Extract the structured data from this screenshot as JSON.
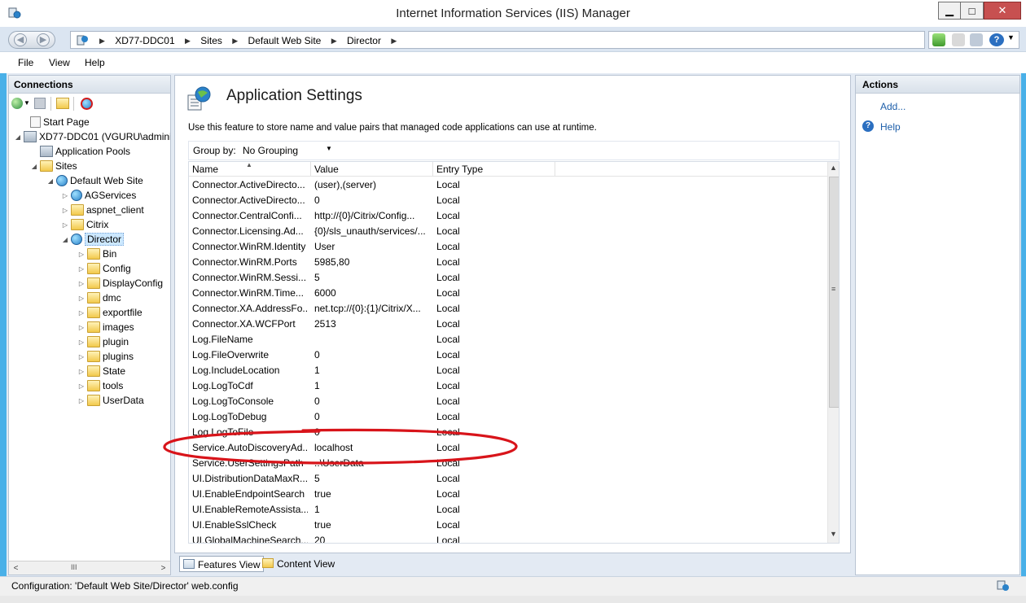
{
  "window": {
    "title": "Internet Information Services (IIS) Manager",
    "min_glyph": "▁",
    "max_glyph": "□",
    "close_glyph": "✕"
  },
  "address": {
    "crumbs": [
      "XD77-DDC01",
      "Sites",
      "Default Web Site",
      "Director"
    ]
  },
  "menu": {
    "file": "File",
    "view": "View",
    "help": "Help"
  },
  "connections": {
    "title": "Connections",
    "tree": [
      {
        "label": "Start Page",
        "icon": "page-icon"
      },
      {
        "label": "XD77-DDC01 (VGURU\\admini",
        "icon": "server-icon"
      },
      {
        "label": "Application Pools",
        "icon": "app-pools-icon"
      },
      {
        "label": "Sites",
        "icon": "sites-folder-icon"
      },
      {
        "label": "Default Web Site",
        "icon": "globe-icon"
      },
      {
        "label": "AGServices",
        "icon": "app-icon"
      },
      {
        "label": "aspnet_client",
        "icon": "folder-icon"
      },
      {
        "label": "Citrix",
        "icon": "folder-icon"
      },
      {
        "label": "Director",
        "icon": "app-icon"
      },
      {
        "label": "Bin",
        "icon": "folder-icon"
      },
      {
        "label": "Config",
        "icon": "folder-icon"
      },
      {
        "label": "DisplayConfig",
        "icon": "folder-icon"
      },
      {
        "label": "dmc",
        "icon": "folder-icon"
      },
      {
        "label": "exportfile",
        "icon": "folder-icon"
      },
      {
        "label": "images",
        "icon": "folder-icon"
      },
      {
        "label": "plugin",
        "icon": "folder-icon"
      },
      {
        "label": "plugins",
        "icon": "folder-icon"
      },
      {
        "label": "State",
        "icon": "folder-icon"
      },
      {
        "label": "tools",
        "icon": "folder-icon"
      },
      {
        "label": "UserData",
        "icon": "folder-icon"
      }
    ],
    "scroll_left": "<",
    "scroll_mid": "III",
    "scroll_right": ">"
  },
  "feature": {
    "title": "Application Settings",
    "description": "Use this feature to store name and value pairs that managed code applications can use at runtime.",
    "group_by_label": "Group by:",
    "group_by_value": "No Grouping",
    "columns": {
      "name": "Name",
      "value": "Value",
      "type": "Entry Type"
    },
    "rows": [
      {
        "name": "Connector.ActiveDirecto...",
        "value": "(user),(server)",
        "type": "Local"
      },
      {
        "name": "Connector.ActiveDirecto...",
        "value": "0",
        "type": "Local"
      },
      {
        "name": "Connector.CentralConfi...",
        "value": "http://{0}/Citrix/Config...",
        "type": "Local"
      },
      {
        "name": "Connector.Licensing.Ad...",
        "value": "{0}/sls_unauth/services/...",
        "type": "Local"
      },
      {
        "name": "Connector.WinRM.Identity",
        "value": "User",
        "type": "Local"
      },
      {
        "name": "Connector.WinRM.Ports",
        "value": "5985,80",
        "type": "Local"
      },
      {
        "name": "Connector.WinRM.Sessi...",
        "value": "5",
        "type": "Local"
      },
      {
        "name": "Connector.WinRM.Time...",
        "value": "6000",
        "type": "Local"
      },
      {
        "name": "Connector.XA.AddressFo...",
        "value": "net.tcp://{0}:{1}/Citrix/X...",
        "type": "Local"
      },
      {
        "name": "Connector.XA.WCFPort",
        "value": "2513",
        "type": "Local"
      },
      {
        "name": "Log.FileName",
        "value": "",
        "type": "Local"
      },
      {
        "name": "Log.FileOverwrite",
        "value": "0",
        "type": "Local"
      },
      {
        "name": "Log.IncludeLocation",
        "value": "1",
        "type": "Local"
      },
      {
        "name": "Log.LogToCdf",
        "value": "1",
        "type": "Local"
      },
      {
        "name": "Log.LogToConsole",
        "value": "0",
        "type": "Local"
      },
      {
        "name": "Log.LogToDebug",
        "value": "0",
        "type": "Local"
      },
      {
        "name": "Log.LogToFile",
        "value": "0",
        "type": "Local"
      },
      {
        "name": "Service.AutoDiscoveryAd...",
        "value": "localhost",
        "type": "Local"
      },
      {
        "name": "Service.UserSettingsPath",
        "value": "..\\UserData",
        "type": "Local"
      },
      {
        "name": "UI.DistributionDataMaxR...",
        "value": "5",
        "type": "Local"
      },
      {
        "name": "UI.EnableEndpointSearch",
        "value": "true",
        "type": "Local"
      },
      {
        "name": "UI.EnableRemoteAssista...",
        "value": "1",
        "type": "Local"
      },
      {
        "name": "UI.EnableSslCheck",
        "value": "true",
        "type": "Local"
      },
      {
        "name": "UI.GlobalMachineSearch...",
        "value": "20",
        "type": "Local"
      }
    ],
    "highlighted_row": "Service.AutoDiscoveryAd...",
    "highlight_color": "#d8141a"
  },
  "view_tabs": {
    "features": "Features View",
    "content": "Content View"
  },
  "actions": {
    "title": "Actions",
    "add": "Add...",
    "help": "Help"
  },
  "status": {
    "text": "Configuration: 'Default Web Site/Director' web.config"
  },
  "colors": {
    "frame": "#49b0e8",
    "link": "#1e5faa",
    "panel_bg": "#e3eaf3"
  }
}
